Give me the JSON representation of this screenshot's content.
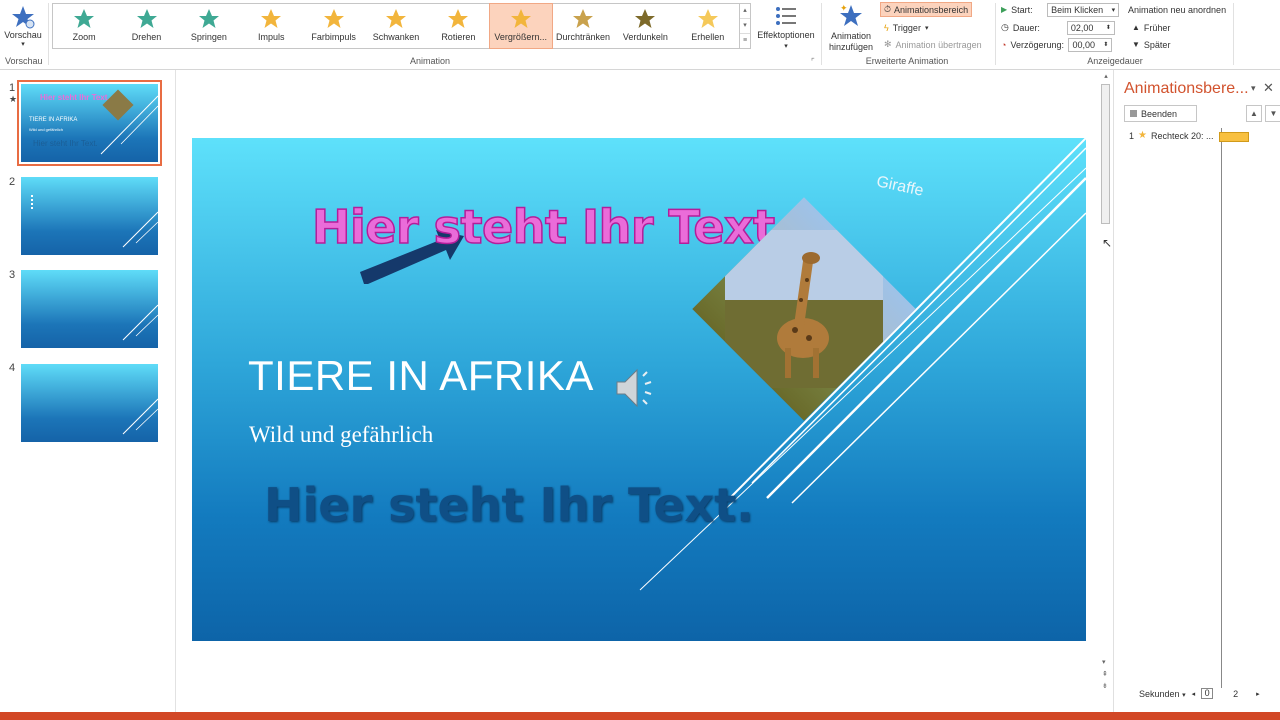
{
  "ribbon": {
    "vorschau": {
      "label": "Vorschau",
      "group_label": "Vorschau"
    },
    "animation_gallery": {
      "group_label": "Animation",
      "items": [
        {
          "label": "Zoom",
          "color": "#3fa994"
        },
        {
          "label": "Drehen",
          "color": "#3fa994"
        },
        {
          "label": "Springen",
          "color": "#3fa994"
        },
        {
          "label": "Impuls",
          "color": "#f2b53c"
        },
        {
          "label": "Farbimpuls",
          "color": "#f2b53c"
        },
        {
          "label": "Schwanken",
          "color": "#f2b53c"
        },
        {
          "label": "Rotieren",
          "color": "#f2b53c"
        },
        {
          "label": "Vergrößern...",
          "color": "#f2b53c"
        },
        {
          "label": "Durchtränken",
          "color": "#c9a24d"
        },
        {
          "label": "Verdunkeln",
          "color": "#7d6a2a"
        },
        {
          "label": "Erhellen",
          "color": "#f5c95a"
        }
      ],
      "selected_index": 7
    },
    "effektoptionen": {
      "label": "Effektoptionen"
    },
    "erweiterte_animation": {
      "group_label": "Erweiterte Animation",
      "add_label_1": "Animation",
      "add_label_2": "hinzufügen",
      "animationsbereich": "Animationsbereich",
      "trigger": "Trigger",
      "uebertragen": "Animation übertragen"
    },
    "anzeigedauer": {
      "group_label": "Anzeigedauer",
      "start_label": "Start:",
      "start_value": "Beim Klicken",
      "dauer_label": "Dauer:",
      "dauer_value": "02,00",
      "verzoegerung_label": "Verzögerung:",
      "verzoegerung_value": "00,00",
      "neu_anordnen": "Animation neu anordnen",
      "frueher": "Früher",
      "spaeter": "Später"
    }
  },
  "thumbnails": [
    {
      "number": "1",
      "marker": "★",
      "title": "Hier steht Ihr Text.",
      "heading": "TIERE IN AFRIKA",
      "sub": "Wild und gefährlich",
      "bottom": "Hier steht Ihr Text."
    },
    {
      "number": "2"
    },
    {
      "number": "3"
    },
    {
      "number": "4"
    }
  ],
  "slide": {
    "pink_text": "Hier steht Ihr Text.",
    "title": "TIERE IN AFRIKA",
    "subtitle": "Wild und gefährlich",
    "blue_text": "Hier steht Ihr Text.",
    "giraffe_label": "Giraffe"
  },
  "anim_pane": {
    "title": "Animationsbere...",
    "beenden": "Beenden",
    "items": [
      {
        "number": "1",
        "label": "Rechteck 20: ..."
      }
    ],
    "seconds_label": "Sekunden",
    "scale_start": "0",
    "scale_end": "2"
  },
  "colors": {
    "accent": "#d24726",
    "selected_bg": "#fcd3bd",
    "pink_text": "#ea6cd9",
    "blue_text": "#0f4f86",
    "timeline_bar": "#f8c040"
  }
}
